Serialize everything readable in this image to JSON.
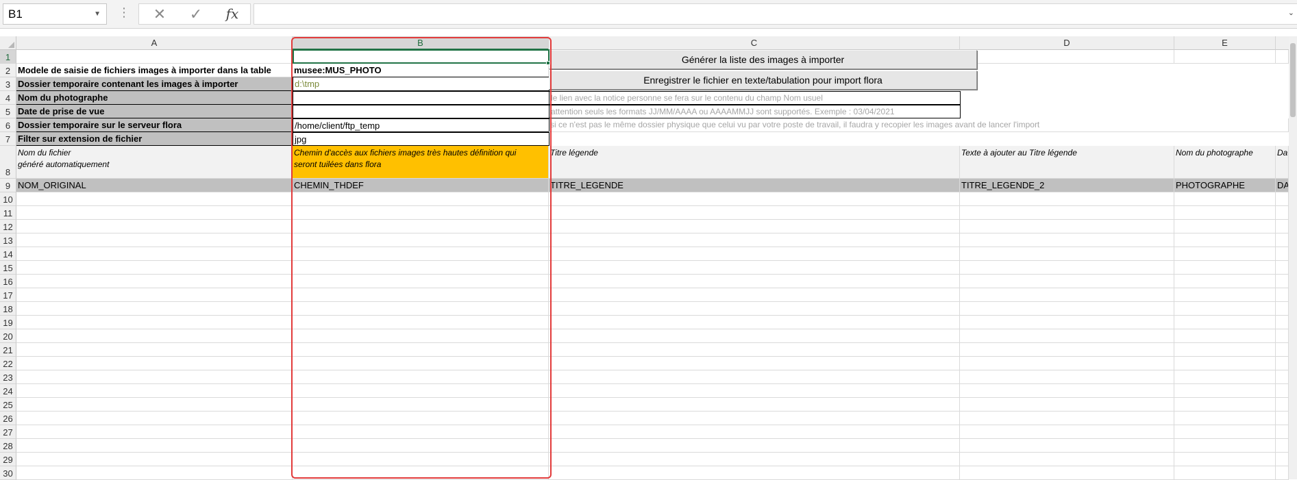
{
  "formula_bar": {
    "name_box": "B1",
    "formula": "",
    "cancel_icon": "✕",
    "enter_icon": "✓",
    "fx_label": "fx"
  },
  "columns": {
    "A": "A",
    "B": "B",
    "C": "C",
    "D": "D",
    "E": "E"
  },
  "rows": [
    "1",
    "2",
    "3",
    "4",
    "5",
    "6",
    "7",
    "8",
    "9",
    "10",
    "11",
    "12",
    "13",
    "14",
    "15",
    "16",
    "17",
    "18",
    "19",
    "20",
    "21",
    "22",
    "23",
    "24",
    "25",
    "26",
    "27",
    "28",
    "29",
    "30"
  ],
  "cells": {
    "A2": "Modele de saisie de fichiers images à importer dans la table",
    "B2": "musee:MUS_PHOTO",
    "A3": "Dossier temporaire contenant les images à importer",
    "B3": "d:\\tmp",
    "A4": "Nom du photographe",
    "C4": "le lien avec la notice personne se fera sur le contenu du champ Nom usuel",
    "A5": "Date de prise de vue",
    "C5": "attention seuls les formats JJ/MM/AAAA ou AAAAMMJJ sont supportés. Exemple : 03/04/2021",
    "A6": "Dossier temporaire sur le serveur flora",
    "B6": "/home/client/ftp_temp",
    "C6": "si ce n'est pas le même dossier physique que celui vu par votre poste de travail, il faudra y recopier les images avant de lancer l'import",
    "A7": "Filter sur extension de fichier",
    "B7": "jpg",
    "A8_line1": "Nom du fichier",
    "A8_line2": "généré automatiquement",
    "B8_line1": "Chemin d'accès aux fichiers  images très hautes définition qui",
    "B8_line2": "seront tuilées dans flora",
    "C8": "Titre légende",
    "D8": "Texte à ajouter au Titre légende",
    "E8": "Nom du photographe",
    "F8": "Date",
    "A9": "NOM_ORIGINAL",
    "B9": "CHEMIN_THDEF",
    "C9": "TITRE_LEGENDE",
    "D9": "TITRE_LEGENDE_2",
    "E9": "PHOTOGRAPHE",
    "F9": "DAT"
  },
  "buttons": {
    "generate": "Générer la liste des images à importer",
    "save": "Enregistrer le fichier en texte/tabulation pour import flora"
  },
  "colors": {
    "accent": "#217346",
    "highlight": "#e23a3a",
    "header_fill": "#ffc000",
    "gray_fill": "#c0c0c0"
  }
}
